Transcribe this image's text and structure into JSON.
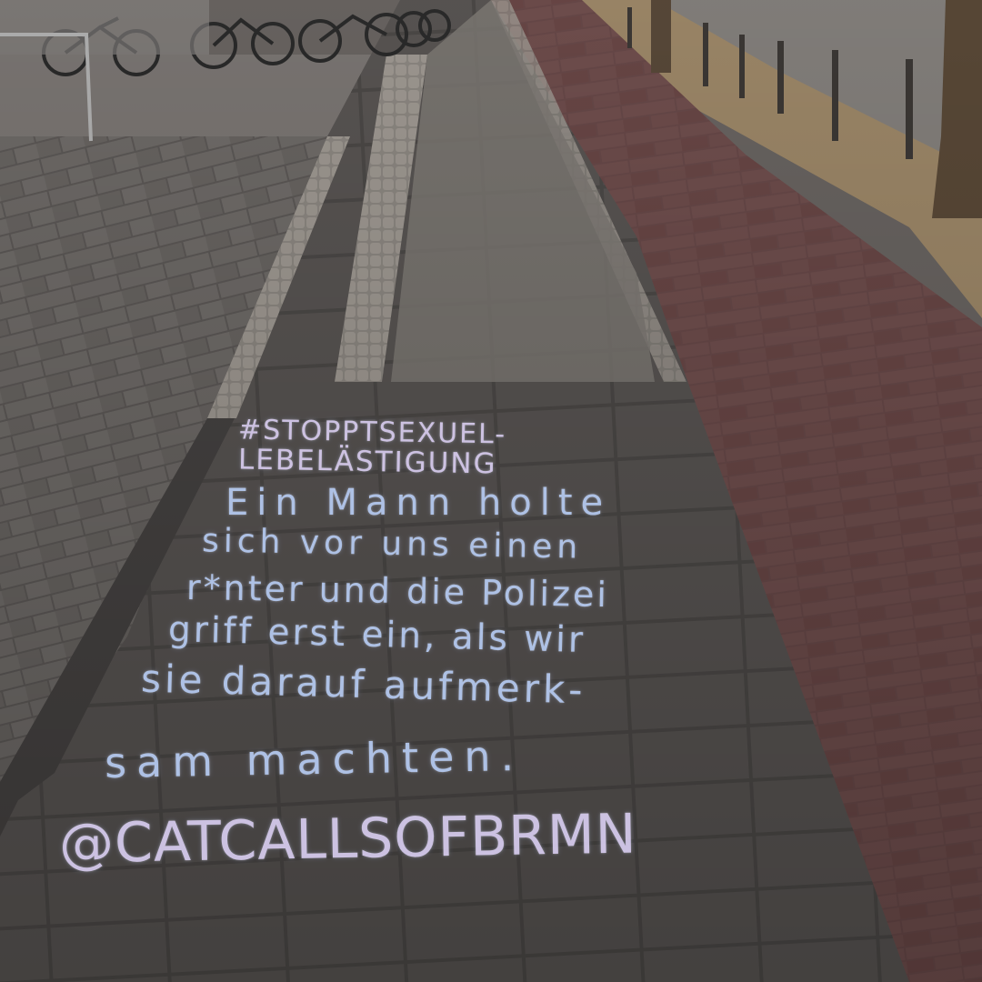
{
  "scene": {
    "subject": "chalk-writing-on-sidewalk",
    "colors": {
      "pavers_gray": "#6e6a67",
      "bike_lane_red": "#6a4848",
      "chalk_blue": "#b7ccf3",
      "chalk_lilac": "#d8cdf0",
      "dry_grass": "#a58c6a",
      "road": "#8a8682"
    }
  },
  "chalk": {
    "lines": [
      "#STOPPTSEXUEL-",
      "LEBELÄSTIGUNG",
      "Ein Mann holte",
      "sich vor uns einen",
      "r*nter und die Polizei",
      "griff erst ein, als wir",
      "sie darauf aufmerk-",
      "sam machten.",
      "@CATCALLSOFBRMN"
    ]
  }
}
